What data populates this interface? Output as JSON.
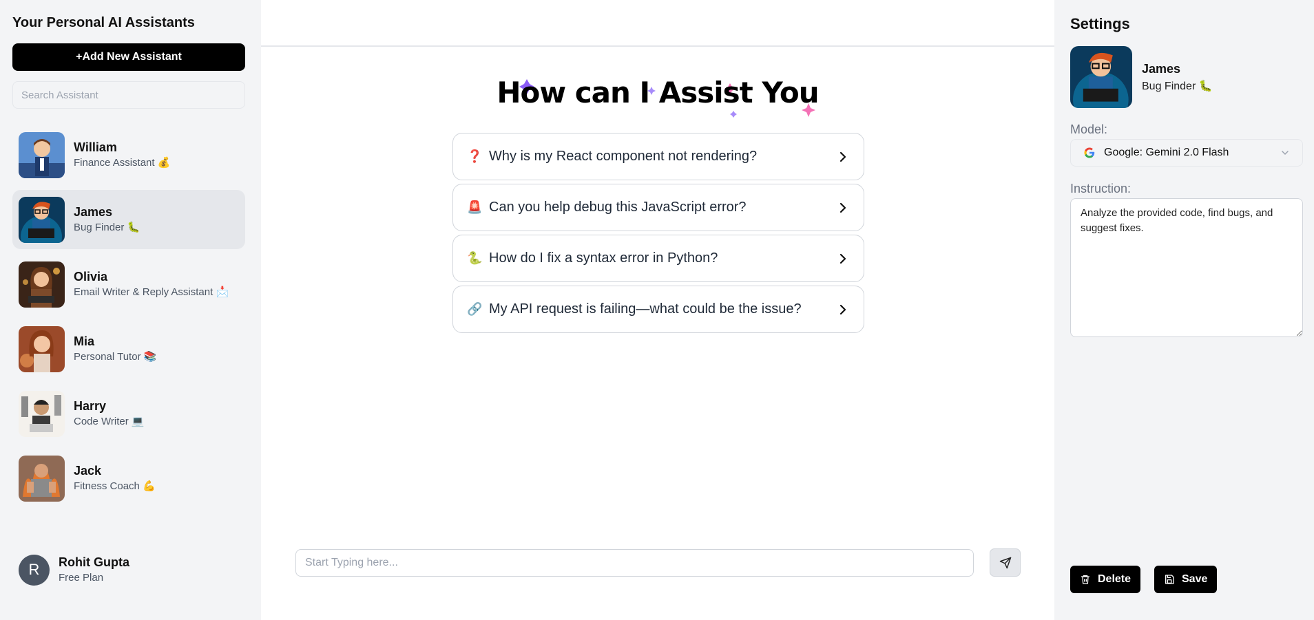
{
  "sidebar": {
    "title": "Your Personal AI Assistants",
    "add_button": "+Add New Assistant",
    "search_placeholder": "Search Assistant",
    "assistants": [
      {
        "name": "William",
        "title": "Finance Assistant 💰"
      },
      {
        "name": "James",
        "title": "Bug Finder 🐛"
      },
      {
        "name": "Olivia",
        "title": "Email Writer & Reply Assistant 📩"
      },
      {
        "name": "Mia",
        "title": "Personal Tutor 📚"
      },
      {
        "name": "Harry",
        "title": "Code Writer 💻"
      },
      {
        "name": "Jack",
        "title": "Fitness Coach 💪"
      }
    ],
    "selected_index": 1,
    "user": {
      "initial": "R",
      "name": "Rohit Gupta",
      "plan": "Free Plan"
    }
  },
  "main": {
    "headline": "How can I Assist You",
    "suggestions": [
      {
        "icon": "❓",
        "icon_name": "question-icon",
        "text": "Why is my React component not rendering?"
      },
      {
        "icon": "🚨",
        "icon_name": "siren-icon",
        "text": "Can you help debug this JavaScript error?"
      },
      {
        "icon": "🐍",
        "icon_name": "python-icon",
        "text": "How do I fix a syntax error in Python?"
      },
      {
        "icon": "🔗",
        "icon_name": "link-icon",
        "text": "My API request is failing—what could be the issue?"
      }
    ],
    "input_placeholder": "Start Typing here..."
  },
  "settings": {
    "title": "Settings",
    "assistant_name": "James",
    "assistant_title": "Bug Finder 🐛",
    "model_label": "Model:",
    "model_value": "Google: Gemini 2.0 Flash",
    "instruction_label": "Instruction:",
    "instruction_value": "Analyze the provided code, find bugs, and suggest fixes.",
    "delete_label": "Delete",
    "save_label": "Save"
  },
  "colors": {
    "sidebar_bg": "#f3f4f6",
    "button_dark": "#000000",
    "selected_bg": "#e5e7eb",
    "sparkle_purple": "#8b5cf6",
    "sparkle_pink": "#f472b6"
  }
}
